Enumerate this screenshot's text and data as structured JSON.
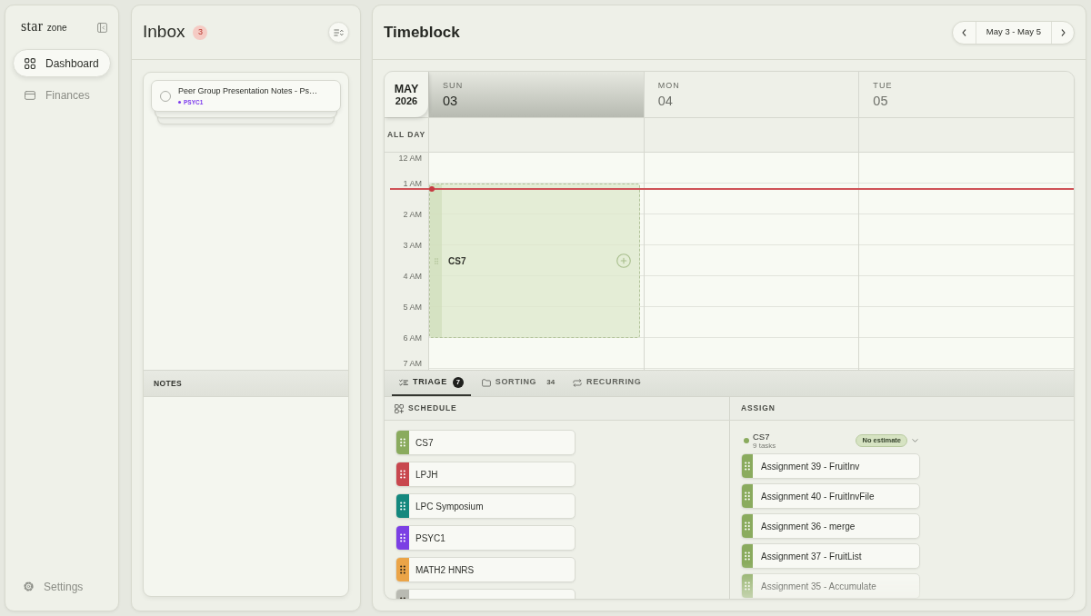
{
  "sidebar": {
    "logo": {
      "mark": "star",
      "name": "zone"
    },
    "nav": [
      {
        "label": "Dashboard",
        "selected": true
      },
      {
        "label": "Finances",
        "selected": false
      }
    ],
    "footer": [
      {
        "label": "Settings"
      }
    ]
  },
  "inbox": {
    "title": "Inbox",
    "count": "3",
    "tasks": [
      {
        "title": "Peer Group Presentation Notes - Ps…",
        "tag": "PSYC1",
        "color": "#7c3aed",
        "checked": false
      }
    ],
    "notes_title": "NOTES"
  },
  "timeblock": {
    "title": "Timeblock",
    "range": "May 3 - May 5",
    "calendar": {
      "month": "MAY",
      "year": "2026",
      "all_day_label": "ALL DAY",
      "days": [
        {
          "weekday": "SUN",
          "date": "03",
          "selected": true,
          "events": [
            {
              "title": "CS7"
            }
          ]
        },
        {
          "weekday": "MON",
          "date": "04",
          "selected": false
        },
        {
          "weekday": "TUE",
          "date": "05",
          "selected": false
        }
      ],
      "hours": [
        "12 AM",
        "1 AM",
        "2 AM",
        "3 AM",
        "4 AM",
        "5 AM",
        "6 AM",
        "7 AM"
      ]
    },
    "tabs": [
      {
        "label": "TRIAGE",
        "count": "7",
        "selected": true
      },
      {
        "label": "SORTING",
        "count": "34",
        "selected": false
      },
      {
        "label": "RECURRING",
        "selected": false
      }
    ],
    "schedule": {
      "title": "SCHEDULE",
      "items": [
        {
          "label": "CS7",
          "color": "#8aab5e"
        },
        {
          "label": "LPJH",
          "color": "#c8474e"
        },
        {
          "label": "LPC Symposium",
          "color": "#14887e"
        },
        {
          "label": "PSYC1",
          "color": "#7b3fe4"
        },
        {
          "label": "MATH2 HNRS",
          "color": "#eba447"
        },
        {
          "color": "#b9bab2"
        }
      ]
    },
    "assign": {
      "title": "ASSIGN",
      "groups": [
        {
          "name": "CS7",
          "color": "#8aab5e",
          "count": "9 tasks",
          "estimate": "No estimate",
          "tasks": [
            {
              "title": "Assignment 39 - FruitInv"
            },
            {
              "title": "Assignment 40 - FruitInvFile"
            },
            {
              "title": "Assignment 36 - merge"
            },
            {
              "title": "Assignment 37 - FruitList"
            },
            {
              "title": "Assignment 35 - Accumulate"
            }
          ]
        }
      ]
    }
  }
}
